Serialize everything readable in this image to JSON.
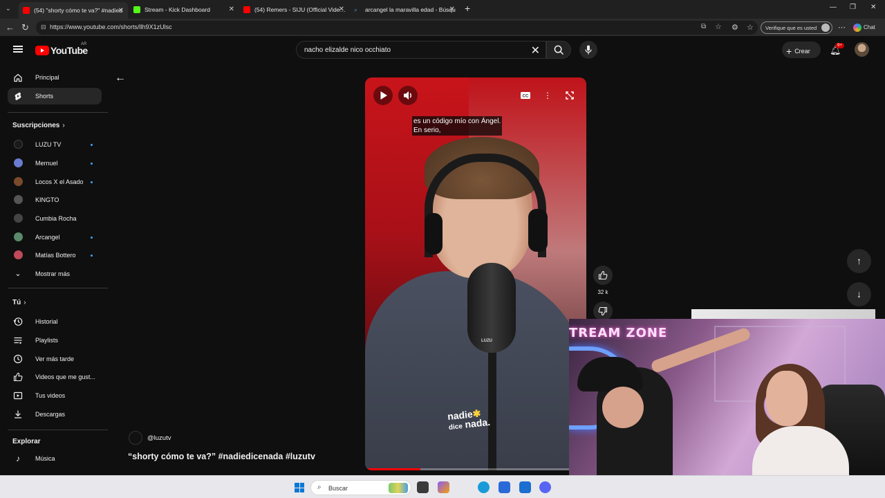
{
  "browser": {
    "tabs": [
      {
        "title": "(54) \"shorty cómo te va?\" #nadied",
        "favicon_color": "#ff0000",
        "active": true
      },
      {
        "title": "Stream - Kick Dashboard",
        "favicon_color": "#53fc18",
        "active": false
      },
      {
        "title": "(54) Remers - SIJU (Official Video) -",
        "favicon_color": "#ff0000",
        "active": false
      },
      {
        "title": "arcangel la maravilla edad - Búsqu",
        "favicon_color": "#4a90e2",
        "active": false
      }
    ],
    "url": "https://www.youtube.com/shorts/llh9X1zUlsc",
    "verify_label": "Verifique que es usted",
    "chat_label": "Chat"
  },
  "youtube": {
    "logo_text": "YouTube",
    "country_code": "AR",
    "search_value": "nacho elizalde nico occhiato",
    "create_label": "Crear",
    "notifications_badge": "9+"
  },
  "sidebar": {
    "main": [
      {
        "label": "Principal",
        "icon": "home-icon",
        "selected": false
      },
      {
        "label": "Shorts",
        "icon": "shorts-icon",
        "selected": true
      }
    ],
    "subscriptions_header": "Suscripciones",
    "subscriptions": [
      {
        "label": "LUZU TV",
        "avatar_color": "#1a1a1a",
        "new": true
      },
      {
        "label": "Mernuel",
        "avatar_color": "#6a7bd0",
        "new": true
      },
      {
        "label": "Locos X el Asado",
        "avatar_color": "#7a4a2a",
        "new": true
      },
      {
        "label": "KINGTO",
        "avatar_color": "#555555",
        "new": false
      },
      {
        "label": "Cumbia Rocha",
        "avatar_color": "#444444",
        "new": false
      },
      {
        "label": "Arcangel",
        "avatar_color": "#5a8a6a",
        "new": true
      },
      {
        "label": "Matías Bottero",
        "avatar_color": "#c04a5a",
        "new": true
      }
    ],
    "show_more_label": "Mostrar más",
    "you_header": "Tú",
    "you_items": [
      {
        "label": "Historial",
        "icon": "history-icon"
      },
      {
        "label": "Playlists",
        "icon": "playlists-icon"
      },
      {
        "label": "Ver más tarde",
        "icon": "watch-later-icon"
      },
      {
        "label": "Videos que me gust...",
        "icon": "liked-videos-icon"
      },
      {
        "label": "Tus videos",
        "icon": "your-videos-icon"
      },
      {
        "label": "Descargas",
        "icon": "downloads-icon"
      }
    ],
    "explore_header": "Explorar",
    "explore_items": [
      {
        "label": "Música",
        "icon": "music-icon"
      }
    ]
  },
  "short": {
    "caption_lines": [
      "es un código mío con Ángel.",
      "En serio,"
    ],
    "watermark_big": "nadie",
    "watermark_small": "dice",
    "watermark_tail": "nada.",
    "mic_brand": "LUZU",
    "progress_fraction": 0.25,
    "like_count": "32 k",
    "channel_handle": "@luzutv",
    "title": "“shorty cómo te va?” #nadiedicenada #luzutv"
  },
  "overlay": {
    "sign_text": "TREAM ZONE"
  },
  "taskbar": {
    "search_placeholder": "Buscar",
    "apps": [
      {
        "name": "file-explorer-icon",
        "color": "#3a3a3a"
      },
      {
        "name": "copilot-icon",
        "color": "#8a5cf6"
      },
      {
        "name": "edge-icon",
        "color": "#1a9bd7"
      },
      {
        "name": "store-icon",
        "color": "#2a6ad8"
      },
      {
        "name": "outlook-icon",
        "color": "#1a6fd0"
      },
      {
        "name": "discord-icon",
        "color": "#5865f2"
      }
    ]
  }
}
